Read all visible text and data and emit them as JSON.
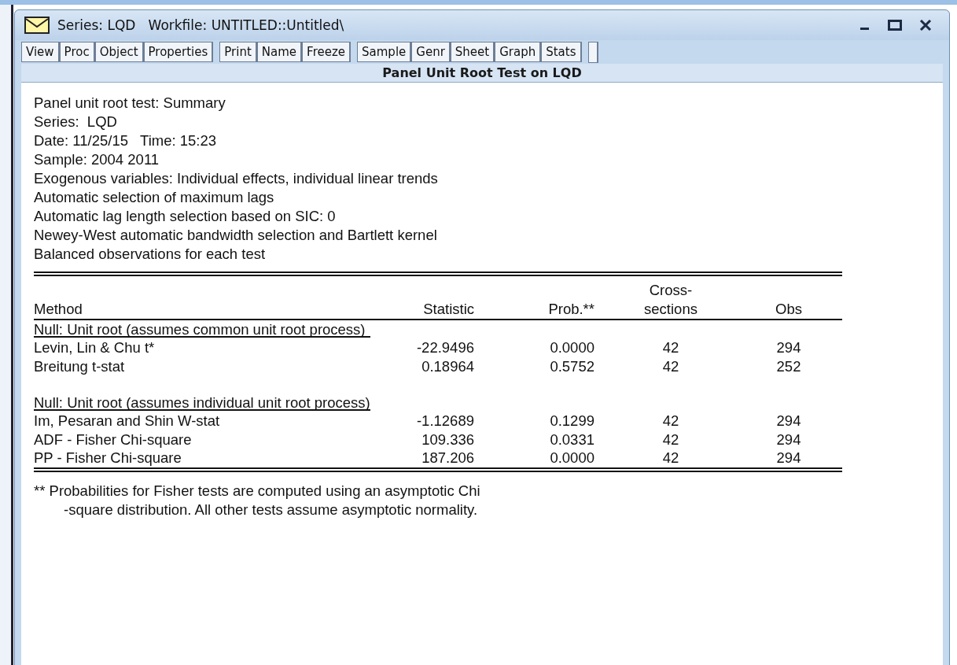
{
  "window": {
    "title": "Series: LQD   Workfile: UNTITLED::Untitled\\"
  },
  "toolbar": {
    "groups": [
      [
        "View",
        "Proc",
        "Object",
        "Properties"
      ],
      [
        "Print",
        "Name",
        "Freeze"
      ],
      [
        "Sample",
        "Genr",
        "Sheet",
        "Graph",
        "Stats"
      ]
    ]
  },
  "view_title": "Panel Unit Root Test on LQD",
  "header_lines": [
    "Panel unit root test: Summary",
    "Series:  LQD",
    "Date: 11/25/15   Time: 15:23",
    "Sample: 2004 2011",
    "Exogenous variables: Individual effects, individual linear trends",
    "Automatic selection of maximum lags",
    "Automatic lag length selection based on SIC: 0",
    "Newey-West automatic bandwidth selection and Bartlett kernel",
    "Balanced observations for each test"
  ],
  "table": {
    "columns": [
      "Method",
      "Statistic",
      "Prob.**",
      "Cross-\nsections",
      "Obs"
    ],
    "groups": [
      {
        "title": "Null: Unit root (assumes common unit root process)",
        "rows": [
          [
            "Levin, Lin & Chu t*",
            "-22.9496",
            "0.0000",
            "42",
            "294"
          ],
          [
            "Breitung t-stat",
            "0.18964",
            "0.5752",
            "42",
            "252"
          ]
        ]
      },
      {
        "title": "Null: Unit root (assumes individual unit root process)",
        "rows": [
          [
            "Im, Pesaran and Shin W-stat",
            "-1.12689",
            "0.1299",
            "42",
            "294"
          ],
          [
            "ADF - Fisher Chi-square",
            "109.336",
            "0.0331",
            "42",
            "294"
          ],
          [
            "PP - Fisher Chi-square",
            "187.206",
            "0.0000",
            "42",
            "294"
          ]
        ]
      }
    ]
  },
  "footnote": [
    "** Probabilities for Fisher tests are computed using an asymptotic Chi",
    "-square distribution. All other tests assume asymptotic normality."
  ]
}
